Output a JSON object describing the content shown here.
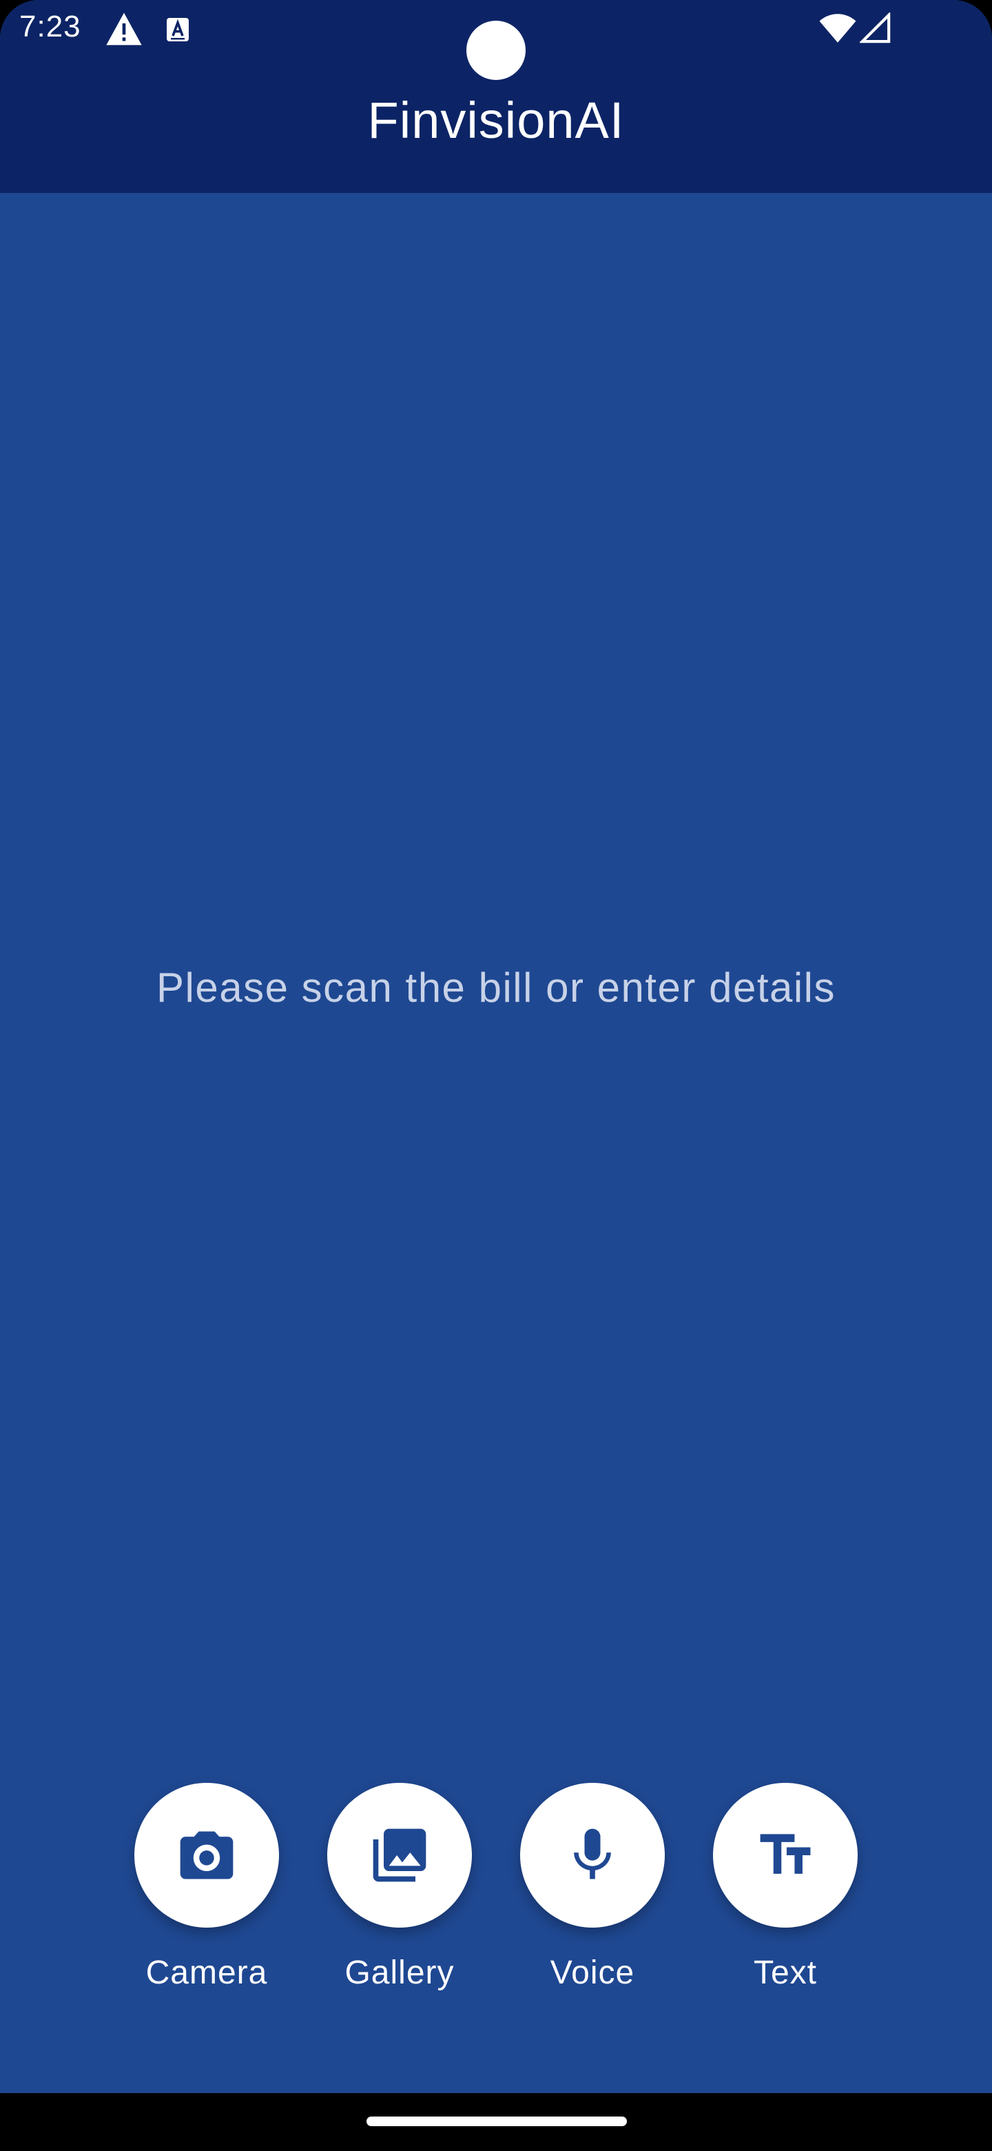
{
  "status_bar": {
    "time": "7:23",
    "icons": [
      "warning-icon",
      "text-input-a-icon",
      "wifi-icon",
      "cell-signal-icon"
    ]
  },
  "app": {
    "title": "FinvisionAI"
  },
  "main": {
    "empty_message": "Please scan the bill or enter details"
  },
  "actions": [
    {
      "label": "Camera",
      "icon": "camera-icon"
    },
    {
      "label": "Gallery",
      "icon": "gallery-icon"
    },
    {
      "label": "Voice",
      "icon": "microphone-icon"
    },
    {
      "label": "Text",
      "icon": "text-fields-icon"
    }
  ],
  "colors": {
    "header_background": "#0C2465",
    "body_background": "#1F4892",
    "button_background": "#FFFFFF",
    "icon_color": "#1F4892",
    "message_color": "#C7D2E8"
  }
}
